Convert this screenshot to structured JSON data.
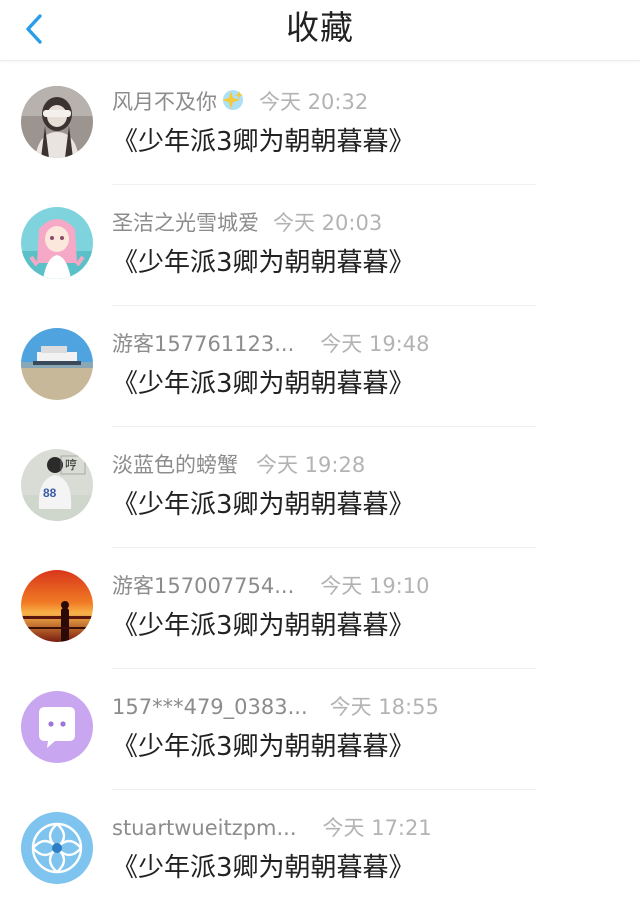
{
  "header": {
    "back_label": "<",
    "title": "收藏",
    "accent_color": "#2a9de8"
  },
  "items": [
    {
      "name": "风月不及你",
      "time": "今天 20:32",
      "content": "《少年派3卿为朝朝暮暮》",
      "name_emoji": "sparkle-star"
    },
    {
      "name": "圣洁之光雪城爱",
      "time": "今天 20:03",
      "content": "《少年派3卿为朝朝暮暮》"
    },
    {
      "name": "游客157761123...",
      "time": "今天 19:48",
      "content": "《少年派3卿为朝朝暮暮》"
    },
    {
      "name": "淡蓝色的螃蟹",
      "time": "今天 19:28",
      "content": "《少年派3卿为朝朝暮暮》"
    },
    {
      "name": "游客157007754...",
      "time": "今天 19:10",
      "content": "《少年派3卿为朝朝暮暮》"
    },
    {
      "name": "157***479_0383...",
      "time": "今天 18:55",
      "content": "《少年派3卿为朝朝暮暮》"
    },
    {
      "name": "stuartwueitzpm...",
      "time": "今天 17:21",
      "content": "《少年派3卿为朝朝暮暮》"
    }
  ]
}
